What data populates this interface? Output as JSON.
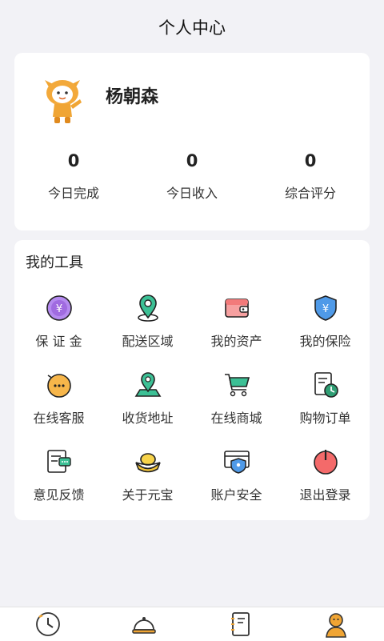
{
  "header": {
    "title": "个人中心"
  },
  "profile": {
    "name": "杨朝森",
    "avatar_icon": "mascot-avatar-icon",
    "stats": [
      {
        "value": "0",
        "label": "今日完成"
      },
      {
        "value": "0",
        "label": "今日收入"
      },
      {
        "value": "0",
        "label": "综合评分"
      }
    ]
  },
  "tools": {
    "title": "我的工具",
    "items": [
      {
        "label": "保 证 金",
        "icon": "deposit-yen-icon"
      },
      {
        "label": "配送区域",
        "icon": "location-pin-icon"
      },
      {
        "label": "我的资产",
        "icon": "wallet-icon"
      },
      {
        "label": "我的保险",
        "icon": "insurance-shield-icon"
      },
      {
        "label": "在线客服",
        "icon": "chat-face-icon"
      },
      {
        "label": "收货地址",
        "icon": "map-pin-icon"
      },
      {
        "label": "在线商城",
        "icon": "cart-icon"
      },
      {
        "label": "购物订单",
        "icon": "order-clock-icon"
      },
      {
        "label": "意见反馈",
        "icon": "feedback-icon"
      },
      {
        "label": "关于元宝",
        "icon": "gold-ingot-icon"
      },
      {
        "label": "账户安全",
        "icon": "account-security-icon"
      },
      {
        "label": "退出登录",
        "icon": "power-icon"
      }
    ]
  },
  "tabbar": {
    "items": [
      {
        "icon": "clock-icon"
      },
      {
        "icon": "service-bell-icon"
      },
      {
        "icon": "notebook-icon"
      },
      {
        "icon": "profile-person-icon",
        "active": true
      }
    ]
  },
  "colors": {
    "accent": "#f0a534",
    "green": "#27b584",
    "purple": "#a06be0",
    "red": "#f25b5b",
    "blue": "#3c8ee8"
  }
}
